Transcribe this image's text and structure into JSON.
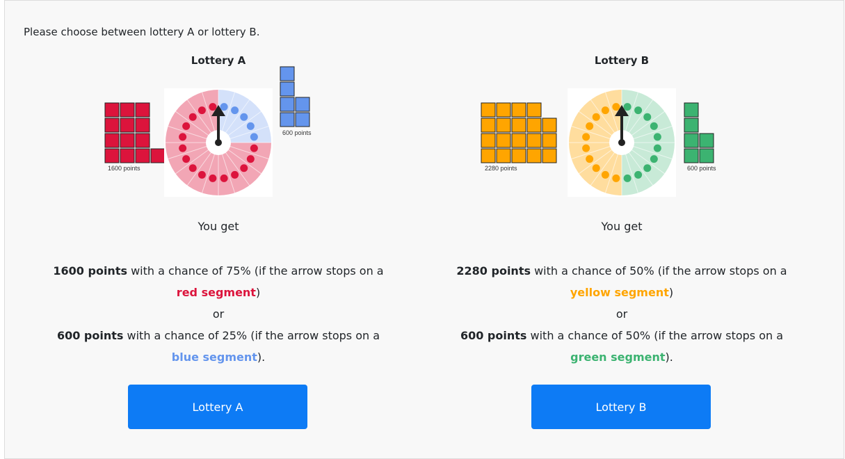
{
  "prompt": "Please choose between lottery A or lottery B.",
  "lotteries": [
    {
      "title": "Lottery A",
      "you_get": "You get",
      "outcomes": [
        {
          "points_text": "1600 points",
          "chance_text": " with a chance of 75% (if the arrow stops on a ",
          "segment_text": "red segment",
          "tail": ")",
          "color": "#dc143c",
          "points": 1600,
          "probability": 0.75,
          "block_count": 13
        },
        {
          "points_text": "600 points",
          "chance_text": " with a chance of 25% (if the arrow stops on a ",
          "segment_text": "blue segment",
          "tail": ").",
          "color": "#6495ed",
          "points": 600,
          "probability": 0.25,
          "block_count": 6
        }
      ],
      "or_text": "or",
      "bar_labels": [
        "1600 points",
        "600 points"
      ],
      "button_label": "Lottery A"
    },
    {
      "title": "Lottery B",
      "you_get": "You get",
      "outcomes": [
        {
          "points_text": "2280 points",
          "chance_text": " with a chance of 50% (if the arrow stops on a ",
          "segment_text": "yellow segment",
          "tail": ")",
          "color": "#ffa500",
          "points": 2280,
          "probability": 0.5,
          "block_count": 19
        },
        {
          "points_text": "600 points",
          "chance_text": " with a chance of 50% (if the arrow stops on a ",
          "segment_text": "green segment",
          "tail": ").",
          "color": "#3cb371",
          "points": 600,
          "probability": 0.5,
          "block_count": 6
        }
      ],
      "or_text": "or",
      "bar_labels": [
        "2280 points",
        "600 points"
      ],
      "button_label": "Lottery B"
    }
  ]
}
